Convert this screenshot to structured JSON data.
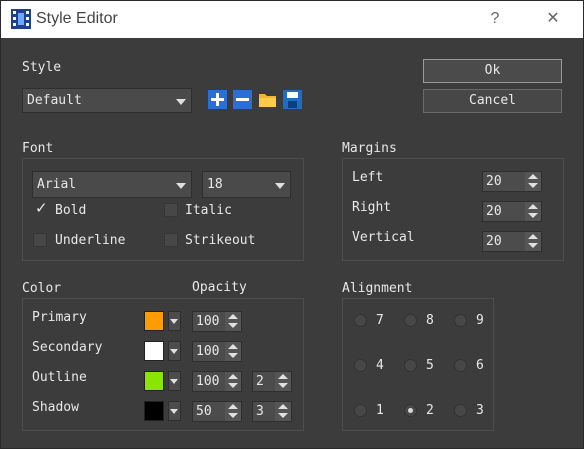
{
  "window": {
    "title": "Style Editor",
    "help_glyph": "?",
    "close_glyph": "✕"
  },
  "style": {
    "label": "Style",
    "selected": "Default",
    "tools": [
      "add-icon",
      "remove-icon",
      "open-folder-icon",
      "save-icon"
    ],
    "ok_label": "Ok",
    "cancel_label": "Cancel"
  },
  "font": {
    "label": "Font",
    "family": "Arial",
    "size": "18",
    "bold_label": "Bold",
    "bold_checked": true,
    "italic_label": "Italic",
    "italic_checked": false,
    "underline_label": "Underline",
    "underline_checked": false,
    "strikeout_label": "Strikeout",
    "strikeout_checked": false
  },
  "margins": {
    "label": "Margins",
    "left_label": "Left",
    "left_value": "20",
    "right_label": "Right",
    "right_value": "20",
    "vertical_label": "Vertical",
    "vertical_value": "20"
  },
  "color": {
    "label": "Color",
    "opacity_label": "Opacity",
    "primary_label": "Primary",
    "primary_color": "#ff9d00",
    "primary_opacity": "100",
    "secondary_label": "Secondary",
    "secondary_color": "#ffffff",
    "secondary_opacity": "100",
    "outline_label": "Outline",
    "outline_color": "#8ae600",
    "outline_opacity": "100",
    "outline_width": "2",
    "shadow_label": "Shadow",
    "shadow_color": "#000000",
    "shadow_opacity": "50",
    "shadow_offset": "3"
  },
  "alignment": {
    "label": "Alignment",
    "options": [
      "7",
      "8",
      "9",
      "4",
      "5",
      "6",
      "1",
      "2",
      "3"
    ],
    "selected": "2"
  }
}
